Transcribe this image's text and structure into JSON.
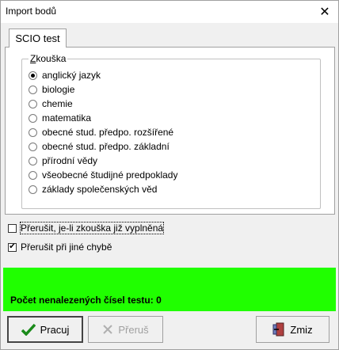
{
  "window": {
    "title": "Import bodů",
    "close_label": "✕"
  },
  "tab": {
    "label": "SCIO test"
  },
  "groupbox": {
    "title": "Zkouška",
    "options": [
      {
        "label": "anglický jazyk",
        "checked": true
      },
      {
        "label": "biologie",
        "checked": false
      },
      {
        "label": "chemie",
        "checked": false
      },
      {
        "label": "matematika",
        "checked": false
      },
      {
        "label": "obecné stud. předpo. rozšířené",
        "checked": false
      },
      {
        "label": "obecné stud. předpo. základní",
        "checked": false
      },
      {
        "label": "přírodní vědy",
        "checked": false
      },
      {
        "label": "všeobecné študijné predpoklady",
        "checked": false
      },
      {
        "label": "základy společenských věd",
        "checked": false
      }
    ]
  },
  "options": {
    "interrupt_filled": {
      "label": "Přerušit, je-li zkouška již vyplněná",
      "checked": false
    },
    "interrupt_error": {
      "label": "Přerušit při jiné chybě",
      "checked": true
    }
  },
  "status": {
    "text": "Počet nenalezených čísel testu: 0",
    "color": "#20ff00"
  },
  "buttons": {
    "run": {
      "label": "Pracuj",
      "icon": "checkmark-icon",
      "enabled": true
    },
    "stop": {
      "label": "Přeruš",
      "icon": "x-icon",
      "enabled": false
    },
    "close": {
      "label": "Zmiz",
      "icon": "door-exit-icon",
      "enabled": true
    }
  }
}
